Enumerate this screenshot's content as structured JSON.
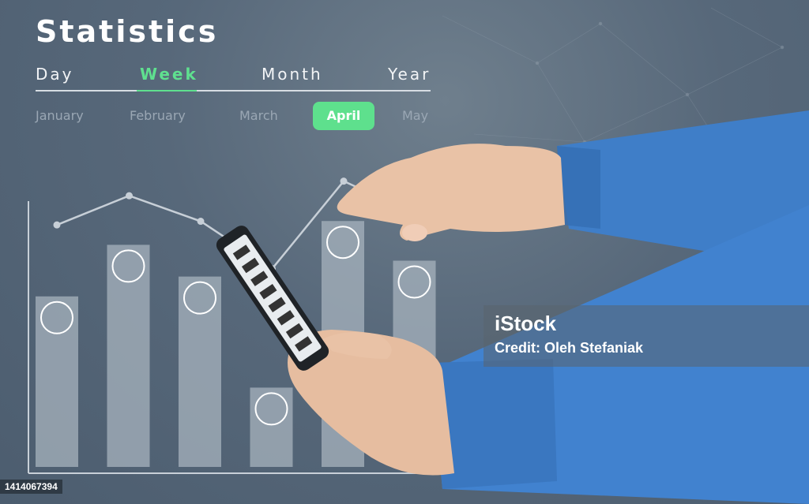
{
  "header": {
    "title": "Statistics"
  },
  "periods": [
    "Day",
    "Week",
    "Month",
    "Year"
  ],
  "active_period": "Week",
  "months": [
    "January",
    "February",
    "March",
    "April",
    "May"
  ],
  "selected_month": "April",
  "colors": {
    "accent": "#5ee08d",
    "background": "#546578",
    "shirt": "#3f7ec8"
  },
  "chart_data": {
    "type": "bar",
    "categories": [
      "",
      "",
      "",
      "",
      "",
      ""
    ],
    "values": [
      43,
      56,
      48,
      20,
      62,
      52
    ],
    "icons": [
      "leaf-coin-icon",
      "vechain-icon",
      "ethereum-icon",
      "cardano-icon",
      "bitcoin-icon",
      "monero-icon"
    ],
    "line_values": [
      62,
      70,
      63,
      50,
      74,
      65
    ],
    "ylim": [
      0,
      70
    ],
    "grid": false
  },
  "watermark": {
    "logo": "iStock",
    "credit": "Credit: Oleh Stefaniak"
  },
  "image_id": "1414067394"
}
